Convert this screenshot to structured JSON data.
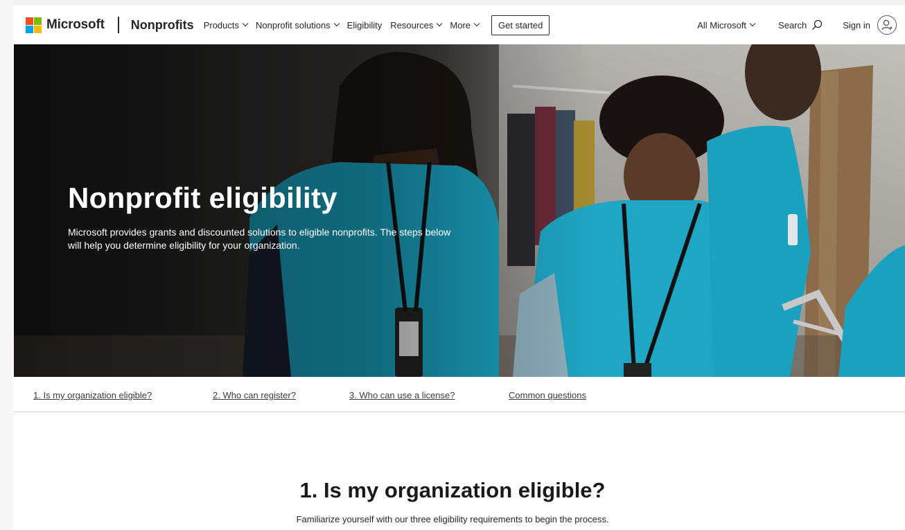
{
  "header": {
    "logo_text": "Microsoft",
    "brand": "Nonprofits",
    "nav": [
      {
        "label": "Products",
        "has_dropdown": true
      },
      {
        "label": "Nonprofit solutions",
        "has_dropdown": true
      },
      {
        "label": "Eligibility",
        "has_dropdown": false
      },
      {
        "label": "Resources",
        "has_dropdown": true
      },
      {
        "label": "More",
        "has_dropdown": true
      }
    ],
    "cta_label": "Get started",
    "all_microsoft": "All Microsoft",
    "search_label": "Search",
    "sign_in": "Sign in"
  },
  "hero": {
    "title": "Nonprofit eligibility",
    "subtitle": "Microsoft provides grants and discounted solutions to eligible nonprofits. The steps below will help you determine eligibility for your organization."
  },
  "anchors": [
    "1. Is my organization eligible?",
    "2. Who can register?",
    "3. Who can use a license?",
    "Common questions"
  ],
  "section": {
    "title": "1. Is my organization eligible?",
    "subtitle": "Familiarize yourself with our three eligibility requirements to begin the process."
  },
  "colors": {
    "logo_red": "#f25022",
    "logo_green": "#7fba00",
    "logo_blue": "#00a4ef",
    "logo_yellow": "#ffb900",
    "shirt_teal": "#1fa6c4",
    "text_dark": "#262626"
  },
  "icons": [
    "microsoft-logo-icon",
    "chevron-down-icon",
    "search-icon",
    "account-icon"
  ]
}
